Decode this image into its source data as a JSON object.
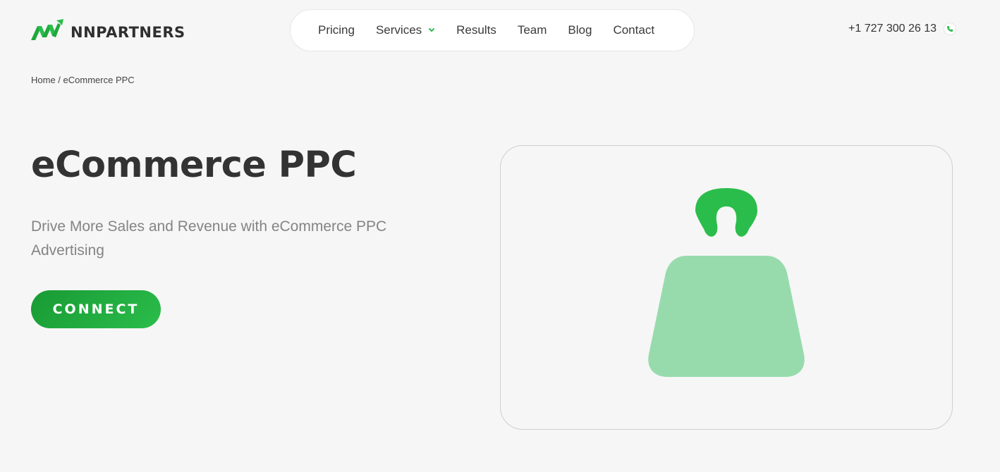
{
  "header": {
    "logo_text": "NNPARTNERS",
    "nav": [
      {
        "label": "Pricing",
        "has_dropdown": false
      },
      {
        "label": "Services",
        "has_dropdown": true
      },
      {
        "label": "Results",
        "has_dropdown": false
      },
      {
        "label": "Team",
        "has_dropdown": false
      },
      {
        "label": "Blog",
        "has_dropdown": false
      },
      {
        "label": "Contact",
        "has_dropdown": false
      }
    ],
    "phone": "+1 727 300 26 13"
  },
  "breadcrumb": {
    "home": "Home",
    "separator": " / ",
    "current": "eCommerce PPC"
  },
  "hero": {
    "title": "eCommerce PPC",
    "subtitle": "Drive More Sales and Revenue with eCommerce PPC Advertising",
    "cta_label": "CONNECT",
    "illustration": "shopping-bag-icon"
  },
  "colors": {
    "brand_green": "#2bbd4b",
    "brand_green_dark": "#189a34",
    "bag_body": "#97dbad",
    "bag_handle": "#2bbd4b",
    "text_dark": "#333333",
    "text_muted": "#848484",
    "background": "#f6f6f6"
  }
}
